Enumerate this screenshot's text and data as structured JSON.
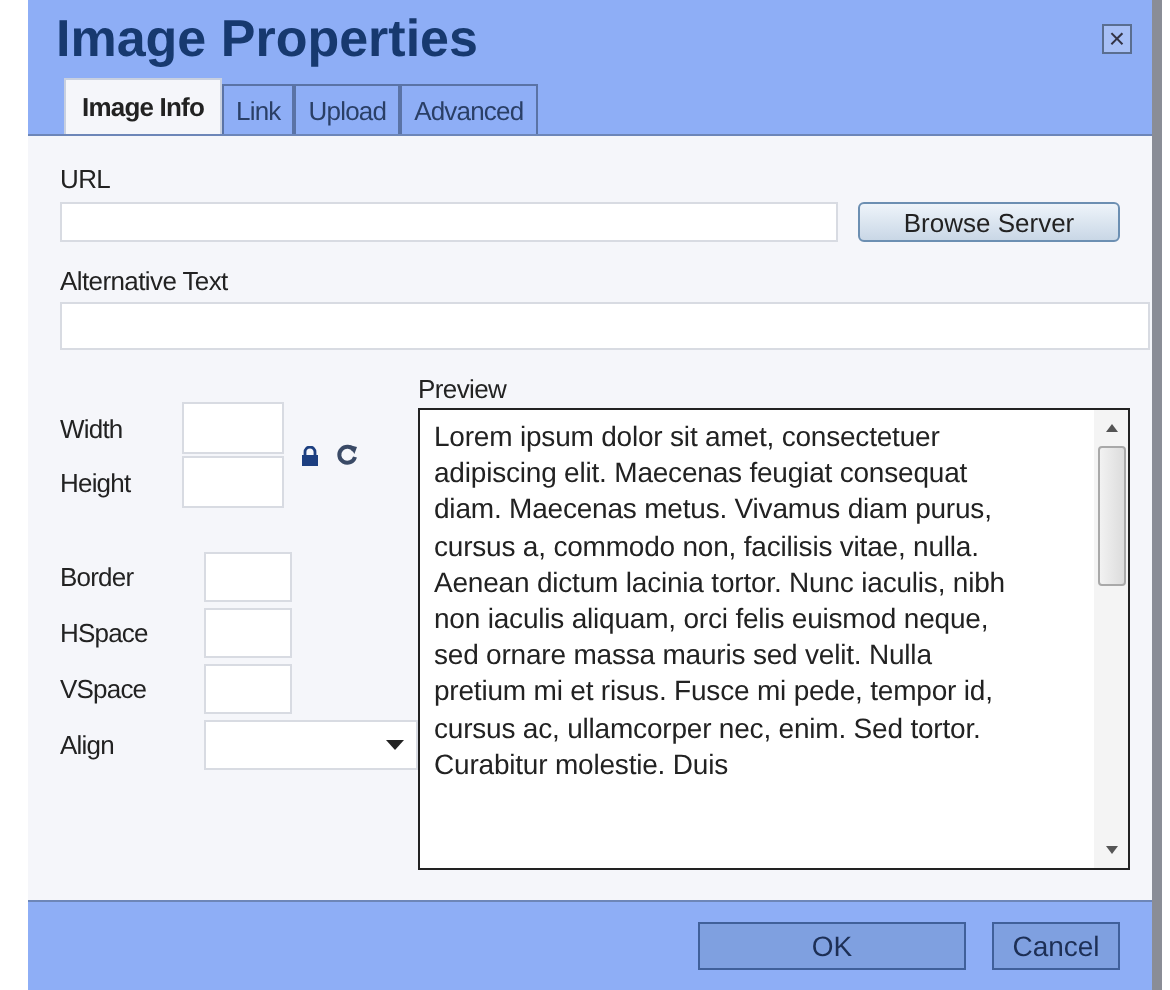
{
  "window": {
    "title": "Image Properties",
    "close": "×"
  },
  "tabs": [
    {
      "label": "Image Info",
      "selected": true
    },
    {
      "label": "Link",
      "selected": false
    },
    {
      "label": "Upload",
      "selected": false
    },
    {
      "label": "Advanced",
      "selected": false
    }
  ],
  "url": {
    "label": "URL",
    "button": "Browse Server"
  },
  "alt_text": {
    "label": "Alternative Text"
  },
  "size_fields": [
    {
      "label": "Width"
    },
    {
      "label": "Height"
    }
  ],
  "spacing_fields": [
    {
      "label": "Border"
    },
    {
      "label": "HSpace"
    },
    {
      "label": "VSpace"
    }
  ],
  "align": {
    "label": "Align"
  },
  "preview": {
    "label": "Preview",
    "text": "Lorem ipsum dolor sit amet, consectetuer adipiscing elit. Maecenas feugiat consequat diam. Maecenas metus. Vivamus diam purus, cursus a, commodo non, facilisis vitae, nulla. Aenean dictum lacinia tortor. Nunc iaculis, nibh non iaculis aliquam, orci felis euismod neque, sed ornare massa mauris sed velit. Nulla pretium mi et risus. Fusce mi pede, tempor id, cursus ac, ullamcorper nec, enim. Sed tortor. Curabitur molestie. Duis"
  },
  "buttons": [
    "OK",
    "Cancel"
  ]
}
